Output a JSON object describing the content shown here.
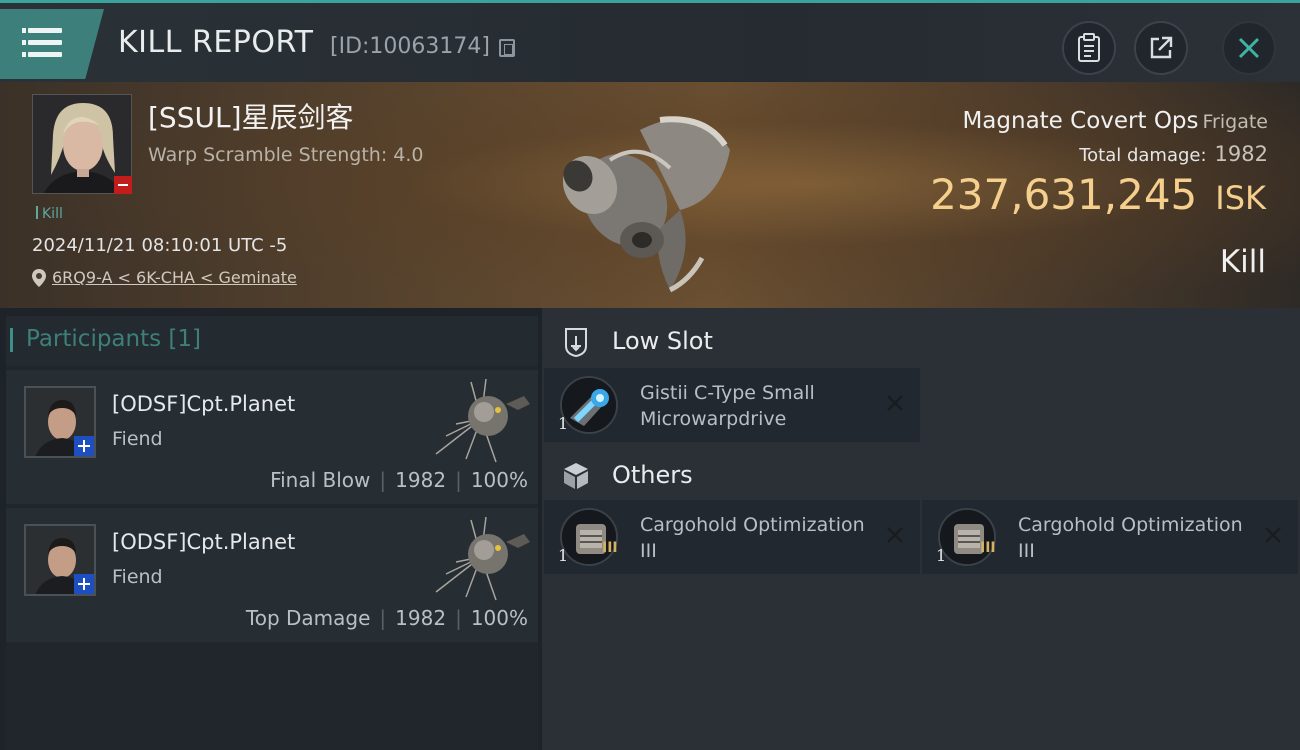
{
  "header": {
    "title": "KILL REPORT",
    "id_label": "[ID:10063174]"
  },
  "victim": {
    "name": "[SSUL]星辰剑客",
    "warp_scramble": "Warp Scramble Strength: 4.0",
    "tag": "Kill",
    "datetime": "2024/11/21 08:10:01 UTC -5",
    "location": "6RQ9-A < 6K-CHA < Geminate",
    "ship_name": "Magnate Covert Ops",
    "ship_class": "Frigate",
    "total_damage_label": "Total damage:",
    "total_damage": "1982",
    "isk_value": "237,631,245",
    "isk_unit": "ISK",
    "result": "Kill"
  },
  "participants": {
    "label": "Participants [1]",
    "rows": [
      {
        "name": "[ODSF]Cpt.Planet",
        "ship": "Fiend",
        "role": "Final Blow",
        "damage": "1982",
        "percent": "100%"
      },
      {
        "name": "[ODSF]Cpt.Planet",
        "ship": "Fiend",
        "role": "Top Damage",
        "damage": "1982",
        "percent": "100%"
      }
    ]
  },
  "fittings": {
    "low_slot_label": "Low Slot",
    "others_label": "Others",
    "low_slot_items": [
      {
        "name": "Gistii C-Type Small Microwarpdrive",
        "qty": "1"
      }
    ],
    "others_items": [
      {
        "name": "Cargohold Optimization III",
        "qty": "1",
        "tier": "III"
      },
      {
        "name": "Cargohold Optimization III",
        "qty": "1",
        "tier": "III"
      }
    ]
  },
  "icons": {
    "menu": "hamburger-icon",
    "copy": "copy-icon",
    "clipboard": "clipboard-icon",
    "share": "share-icon",
    "close": "close-icon",
    "location": "location-pin-icon",
    "low_slot": "low-slot-icon",
    "others": "cube-icon",
    "destroyed": "x-icon"
  },
  "colors": {
    "accent_teal": "#3aa39a",
    "isk_gold": "#f4cf8d",
    "standing_negative": "#c21c1c",
    "standing_positive": "#1e4fc0"
  }
}
